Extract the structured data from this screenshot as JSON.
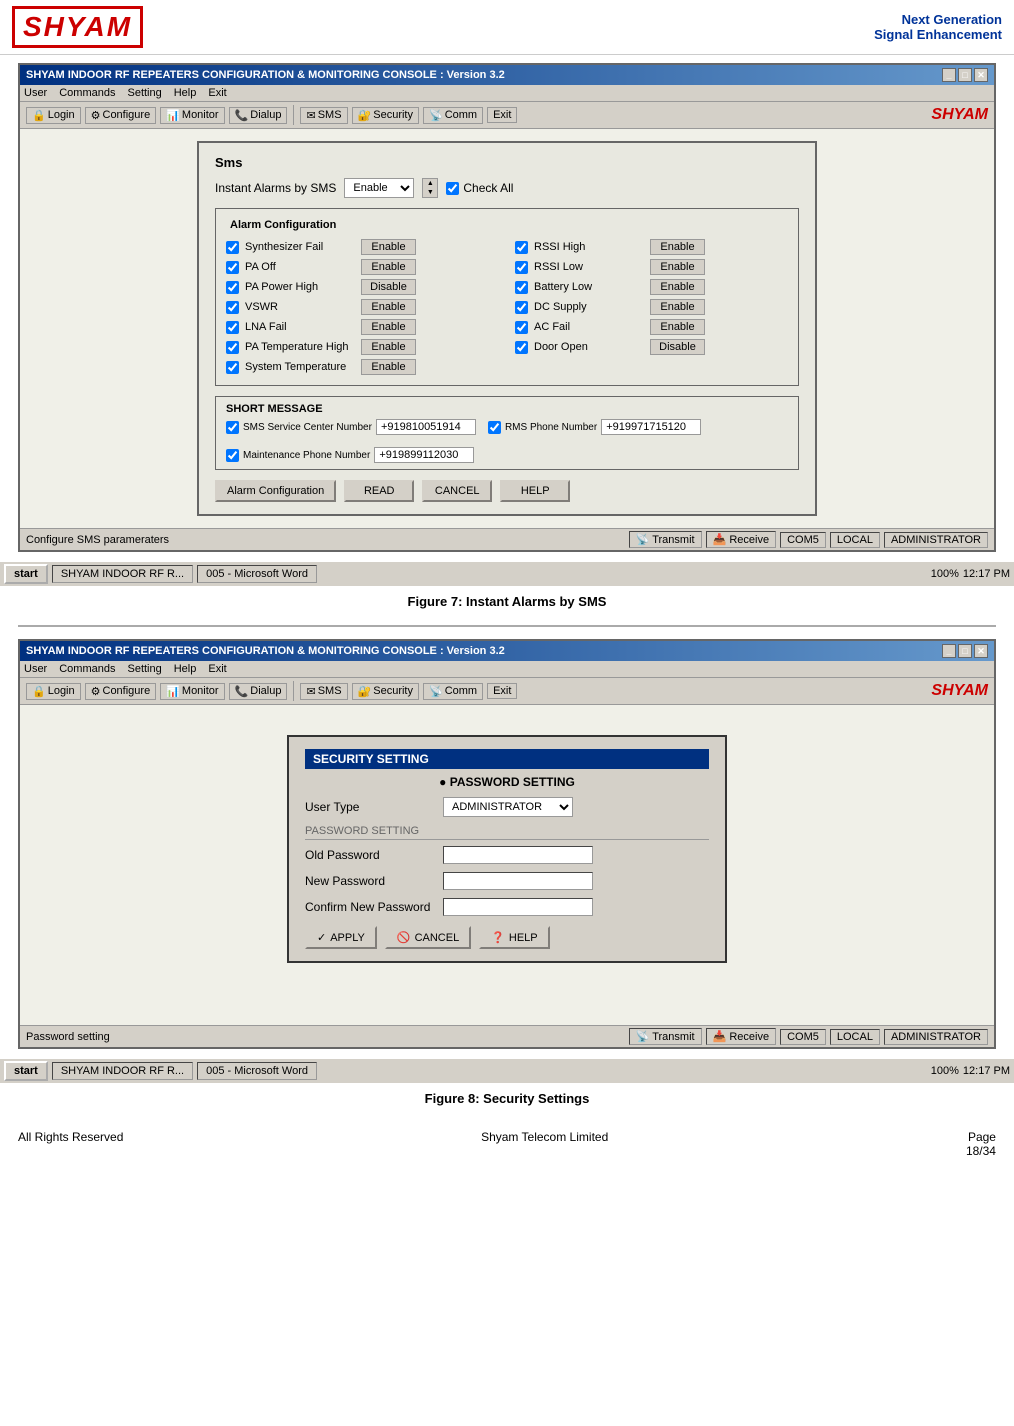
{
  "header": {
    "logo": "SHYAM",
    "tagline_line1": "Next Generation",
    "tagline_line2": "Signal Enhancement"
  },
  "figure7": {
    "window_title": "SHYAM INDOOR RF REPEATERS  CONFIGURATION & MONITORING CONSOLE  :  Version 3.2",
    "menu_items": [
      "User",
      "Commands",
      "Setting",
      "Help",
      "Exit"
    ],
    "toolbar_items": [
      "Login",
      "Configure",
      "Monitor",
      "Dialup",
      "SMS",
      "Security",
      "Comm",
      "Exit"
    ],
    "panel_title": "Sms",
    "instant_alarms_label": "Instant Alarms by SMS",
    "enable_value": "Enable",
    "check_all_label": "Check All",
    "alarm_config_label": "Alarm Configuration",
    "alarms_left": [
      {
        "label": "Synthesizer Fail",
        "value": "Enable",
        "checked": true
      },
      {
        "label": "PA Off",
        "value": "Enable",
        "checked": true
      },
      {
        "label": "PA Power High",
        "value": "Disable",
        "checked": true
      },
      {
        "label": "VSWR",
        "value": "Enable",
        "checked": true
      },
      {
        "label": "LNA Fail",
        "value": "Enable",
        "checked": true
      },
      {
        "label": "PA Temperature High",
        "value": "Enable",
        "checked": true
      },
      {
        "label": "System Temperature",
        "value": "Enable",
        "checked": true
      }
    ],
    "alarms_right": [
      {
        "label": "RSSI High",
        "value": "Enable",
        "checked": true
      },
      {
        "label": "RSSI Low",
        "value": "Enable",
        "checked": true
      },
      {
        "label": "Battery Low",
        "value": "Enable",
        "checked": true
      },
      {
        "label": "DC Supply",
        "value": "Enable",
        "checked": true
      },
      {
        "label": "AC Fail",
        "value": "Enable",
        "checked": true
      },
      {
        "label": "Door Open",
        "value": "Disable",
        "checked": true
      }
    ],
    "short_msg_label": "SHORT MESSAGE",
    "sms_service_label": "SMS Service Center Number",
    "rms_phone_label": "RMS Phone Number",
    "maint_phone_label": "Maintenance Phone Number",
    "sms_number": "+919810051914",
    "rms_number": "+919971715120",
    "maint_number": "+919899112030",
    "btn_alarm_config": "Alarm Configuration",
    "btn_read": "READ",
    "btn_cancel": "CANCEL",
    "btn_help": "HELP",
    "status_left": "Configure SMS parameraters",
    "status_transmit": "Transmit",
    "status_receive": "Receive",
    "status_com": "COM5",
    "status_local": "LOCAL",
    "status_admin": "ADMINISTRATOR"
  },
  "figure7_caption": "Figure 7: Instant Alarms by SMS",
  "figure8": {
    "window_title": "SHYAM INDOOR RF REPEATERS  CONFIGURATION & MONITORING CONSOLE  :  Version 3.2",
    "menu_items": [
      "User",
      "Commands",
      "Setting",
      "Help",
      "Exit"
    ],
    "toolbar_items": [
      "Login",
      "Configure",
      "Monitor",
      "Dialup",
      "SMS",
      "Security",
      "Comm",
      "Exit"
    ],
    "panel_title": "SECURITY SETTING",
    "password_section": "● PASSWORD SETTING",
    "user_type_label": "User Type",
    "user_type_value": "ADMINISTRATOR",
    "pwd_section_label": "PASSWORD SETTING",
    "old_pwd_label": "Old Password",
    "new_pwd_label": "New Password",
    "confirm_pwd_label": "Confirm New Password",
    "btn_apply": "APPLY",
    "btn_cancel": "CANCEL",
    "btn_help": "HELP",
    "status_left": "Password setting",
    "status_transmit": "Transmit",
    "status_receive": "Receive",
    "status_com": "COM5",
    "status_local": "LOCAL",
    "status_admin": "ADMINISTRATOR"
  },
  "figure8_caption": "Figure 8: Security Settings",
  "footer": {
    "left": "All Rights Reserved",
    "center": "Shyam Telecom Limited",
    "right_label": "Page",
    "right_page": "18/34"
  },
  "taskbar": {
    "start": "start",
    "task1": "SHYAM INDOOR RF R...",
    "task2": "005 - Microsoft Word",
    "time": "12:17 PM",
    "zoom": "100%"
  }
}
